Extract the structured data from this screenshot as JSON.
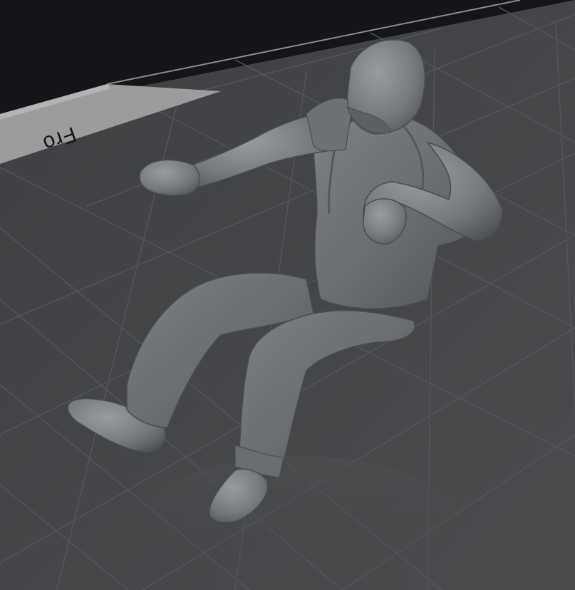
{
  "viewport": {
    "background_color": "#141518",
    "floor_color": "#434446",
    "grid_line_color": "#56575a",
    "model_color": "#75787a"
  },
  "view_cube": {
    "face_label": "Fro",
    "face_color": "#9c9c9c",
    "icon": "view-cube-icon"
  },
  "model": {
    "icon": "figure-model-icon"
  }
}
